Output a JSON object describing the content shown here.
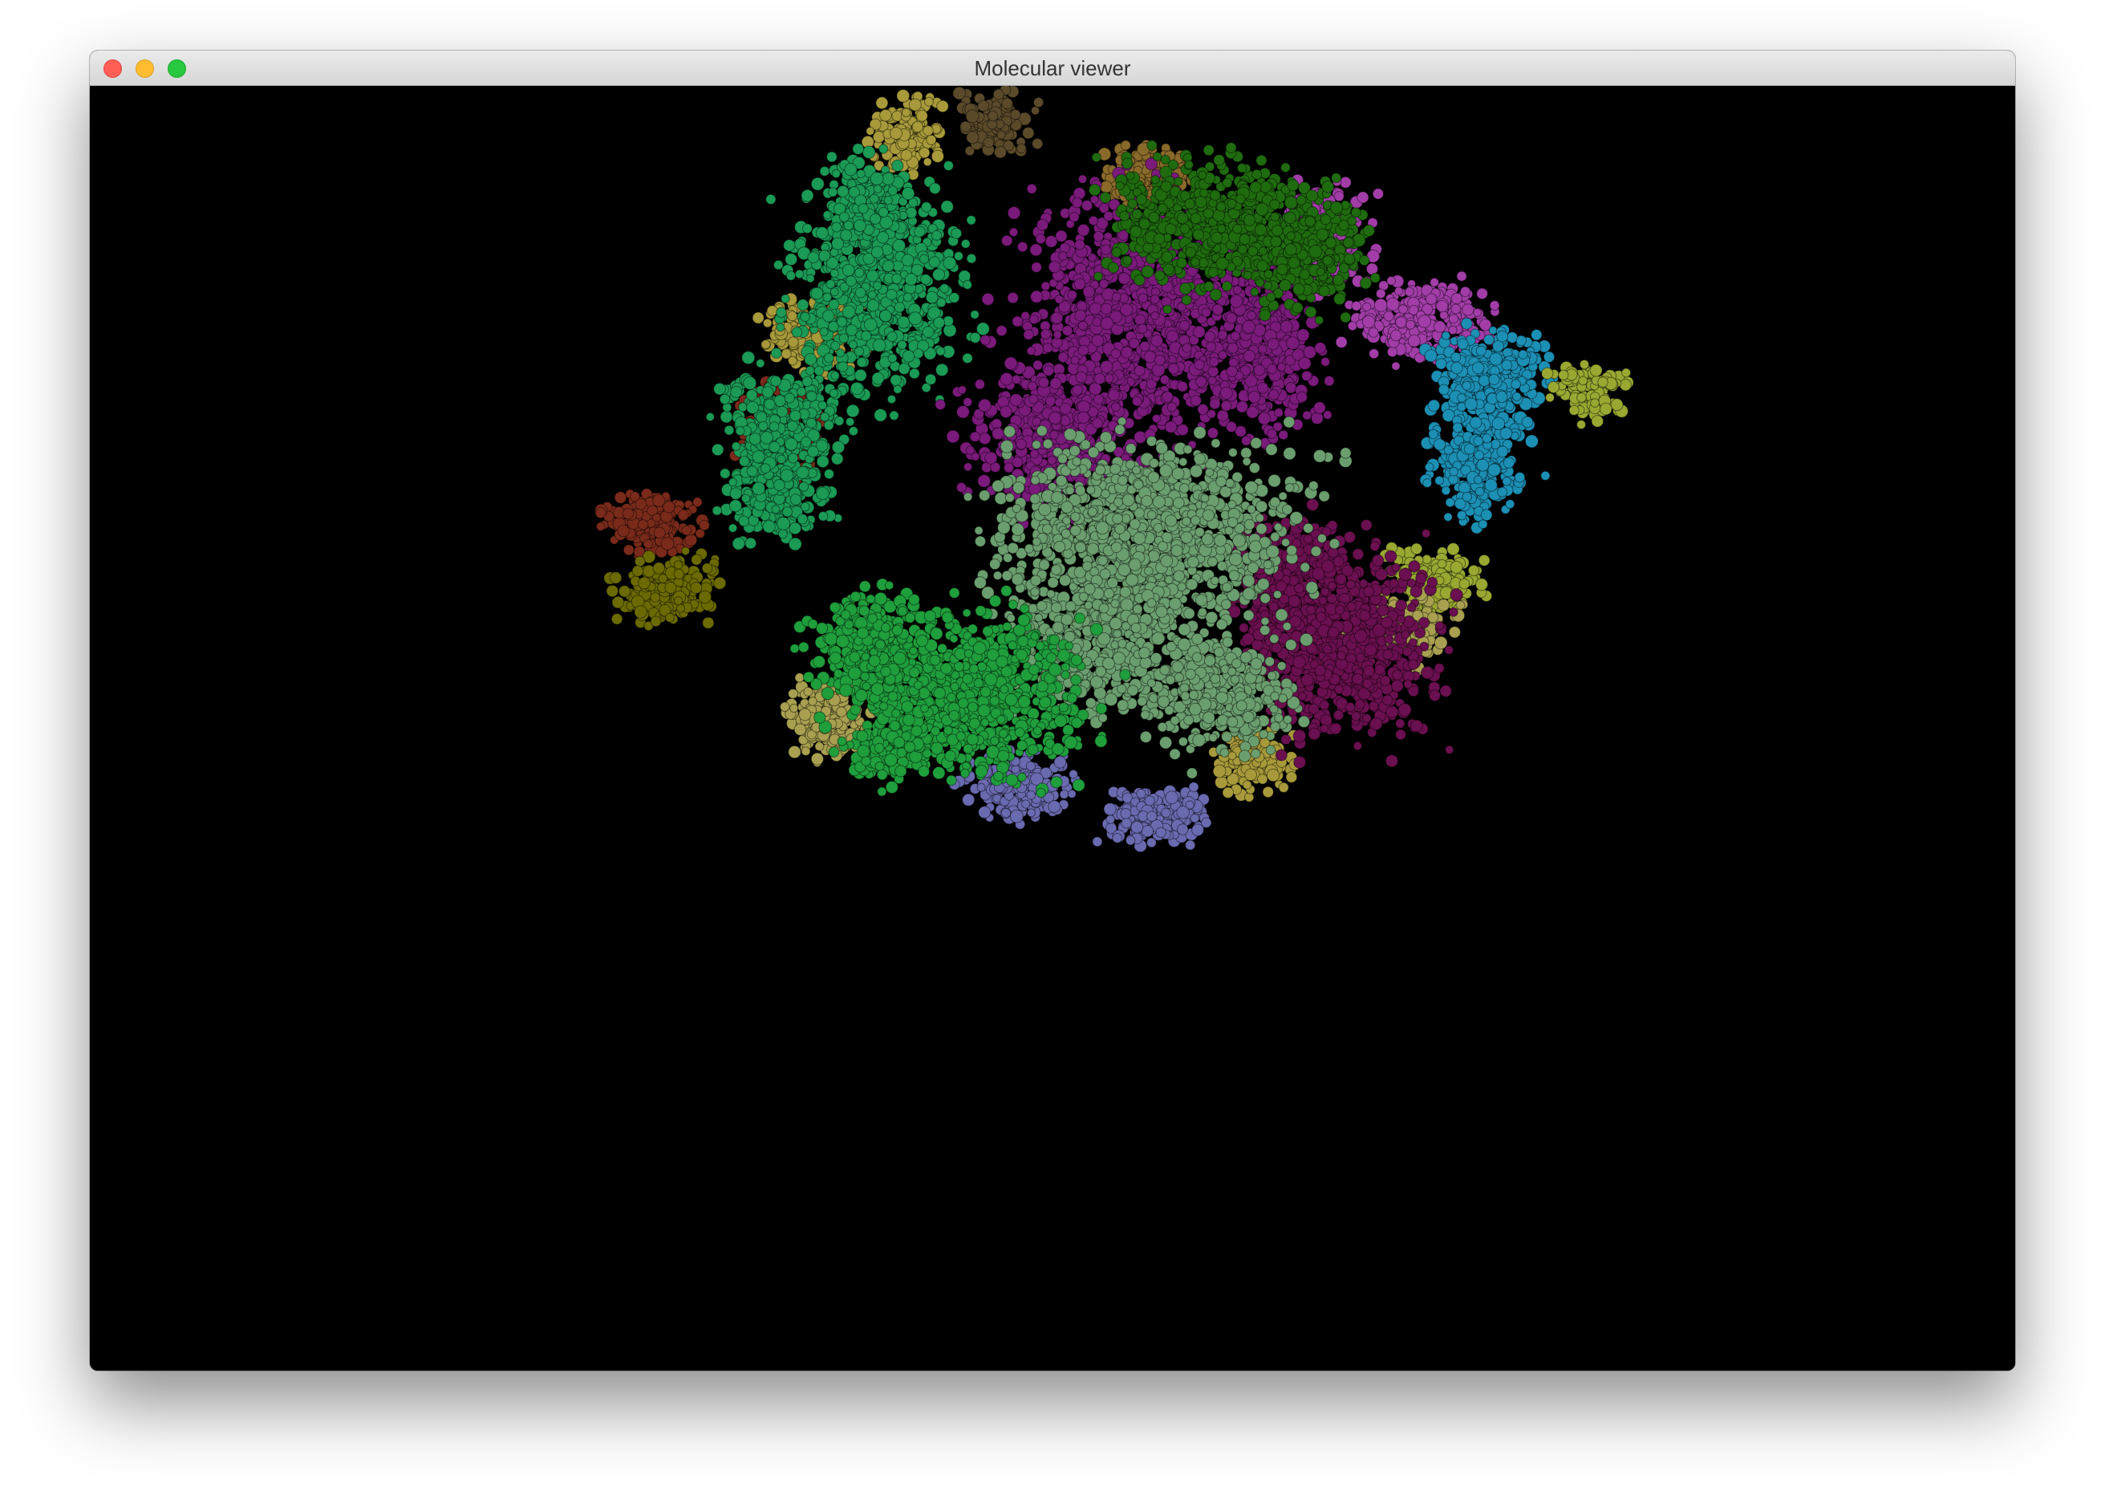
{
  "window": {
    "title": "Molecular viewer",
    "buttons": [
      "close",
      "minimize",
      "zoom"
    ]
  },
  "viewport": {
    "background": "#000000",
    "chain_colors": [
      "#1a9a55",
      "#7a1a7a",
      "#1f6b0f",
      "#a23da8",
      "#1c8fb4",
      "#6a0f4f",
      "#6b9e6e",
      "#1f9e3c",
      "#6a6a00",
      "#7a2a1a",
      "#a89a3a",
      "#8a6a2a",
      "#6a6ab0",
      "#9aa832",
      "#5a4a2a",
      "#a8a050"
    ]
  }
}
